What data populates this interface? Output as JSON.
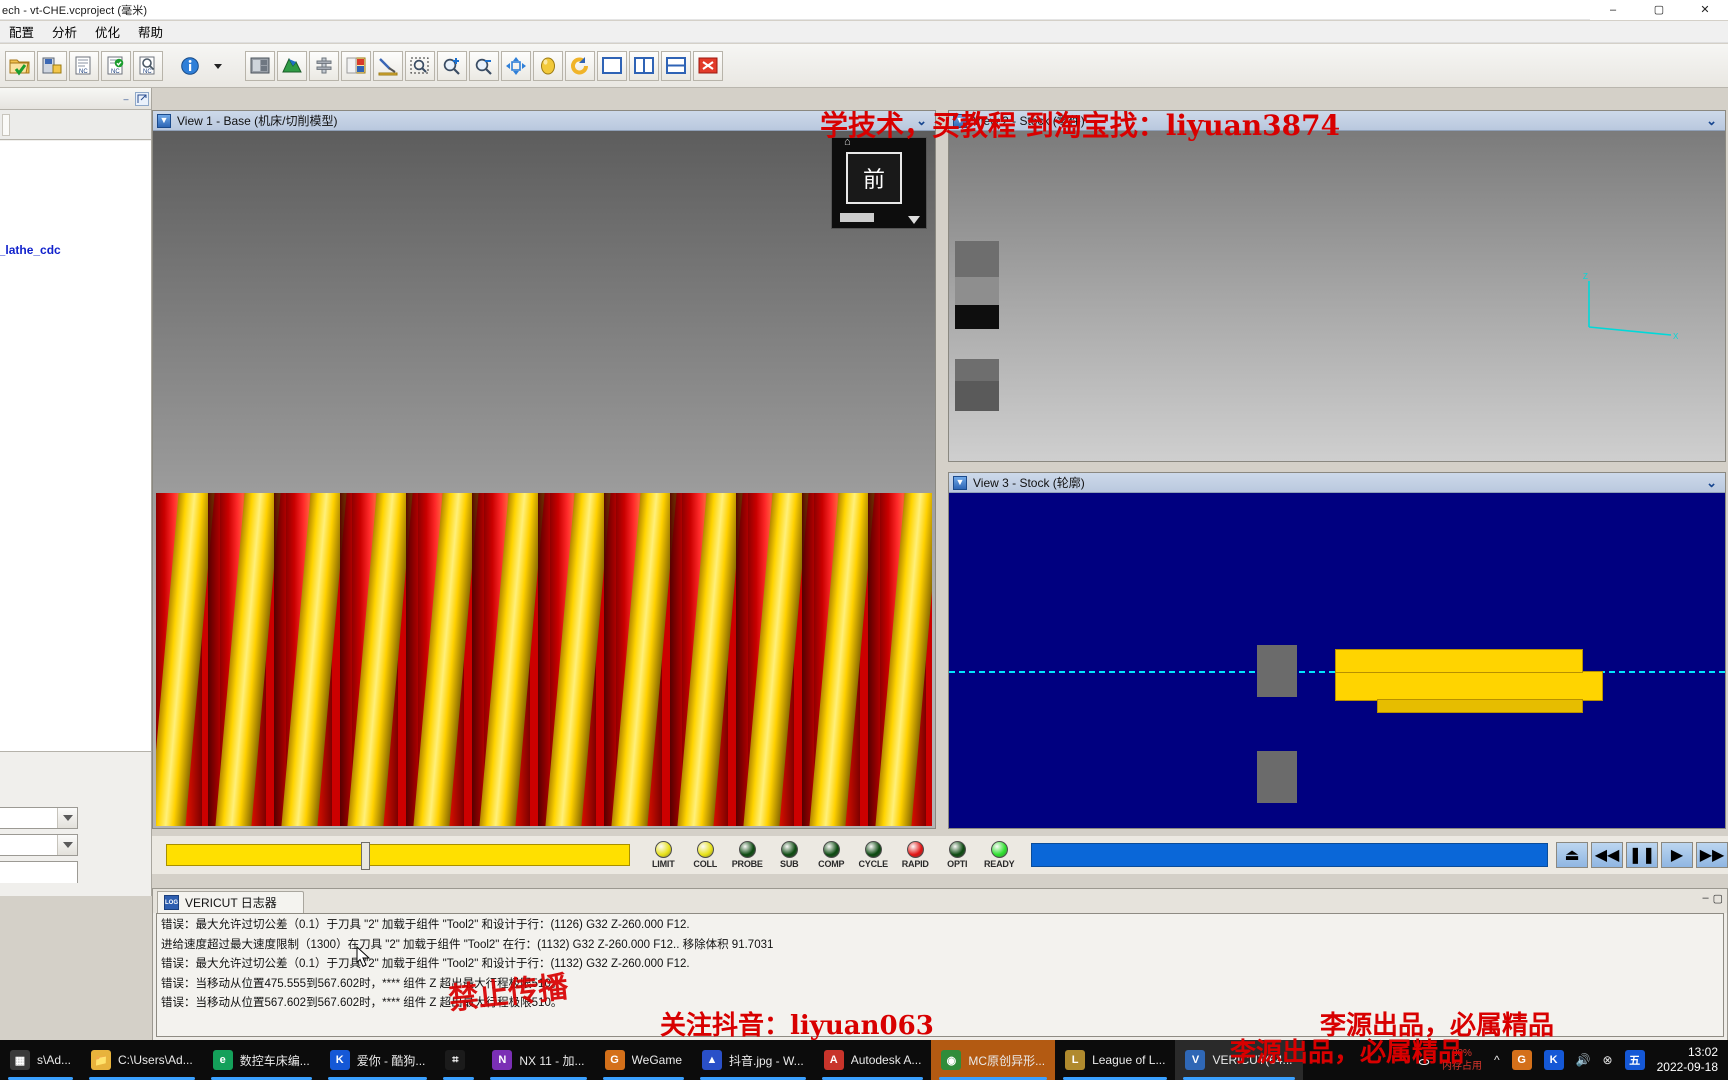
{
  "window": {
    "title": "ech - vt-CHE.vcproject (毫米)",
    "minimize": "–",
    "maximize": "▢",
    "close": "✕"
  },
  "menu": {
    "items": [
      {
        "label": "配置",
        "name": "menu-config"
      },
      {
        "label": "分析",
        "name": "menu-analysis"
      },
      {
        "label": "优化",
        "name": "menu-optimize"
      },
      {
        "label": "帮助",
        "name": "menu-help"
      }
    ]
  },
  "toolbar": {
    "buttons": [
      {
        "name": "open-project-icon",
        "tip": "打开项目"
      },
      {
        "name": "save-project-icon",
        "tip": "保存项目"
      },
      {
        "name": "nc-program-list-icon",
        "tip": "NC 程序"
      },
      {
        "name": "nc-program-check-icon",
        "tip": "NC 程序校验"
      },
      {
        "name": "nc-program-search-icon",
        "tip": "NC 程序查找"
      },
      {
        "name": "info-icon",
        "tip": "信息"
      },
      {
        "name": "dropdown-arrow-icon",
        "tip": "更多"
      },
      {
        "name": "machine-view-icon",
        "tip": "机床视图"
      },
      {
        "name": "workpiece-icon",
        "tip": "工件"
      },
      {
        "name": "fixture-icon",
        "tip": "夹具"
      },
      {
        "name": "tool-manager-icon",
        "tip": "刀具管理"
      },
      {
        "name": "measure-icon",
        "tip": "测量"
      },
      {
        "name": "zoom-box-icon",
        "tip": "框选缩放"
      },
      {
        "name": "zoom-in-icon",
        "tip": "放大"
      },
      {
        "name": "zoom-out-icon",
        "tip": "缩小"
      },
      {
        "name": "fit-icon",
        "tip": "适应窗口"
      },
      {
        "name": "stock-sphere-icon",
        "tip": "毛坯"
      },
      {
        "name": "rotate-icon",
        "tip": "旋转"
      },
      {
        "name": "single-view-icon",
        "tip": "单视图"
      },
      {
        "name": "dual-view-icon",
        "tip": "双视图"
      },
      {
        "name": "split-view-icon",
        "tip": "分割视图"
      },
      {
        "name": "close-view-icon",
        "tip": "关闭视图"
      }
    ]
  },
  "left_panel": {
    "tree_item": "s_turret_lathe_cdc",
    "combo_values": [
      "",
      "",
      ""
    ],
    "minimize_label": "–"
  },
  "views": [
    {
      "id": "view1",
      "title": "View 1 - Base (机床/切削模型)",
      "collapse": "⌄",
      "orientation_cube": {
        "face_label": "前",
        "home_icon": "⌂"
      }
    },
    {
      "id": "view2",
      "title": "View 2 - Stock (零件)",
      "collapse": "⌄",
      "axis_labels": {
        "x": "X",
        "y": "Y",
        "z": "Z"
      }
    },
    {
      "id": "view3",
      "title": "View 3 - Stock (轮廓)",
      "collapse": "⌄"
    }
  ],
  "status_lights": [
    {
      "label": "LIMIT",
      "color": "#e8e218"
    },
    {
      "label": "COLL",
      "color": "#e8e218"
    },
    {
      "label": "PROBE",
      "color": "#0c4a10"
    },
    {
      "label": "SUB",
      "color": "#0c4a10"
    },
    {
      "label": "COMP",
      "color": "#0c4a10"
    },
    {
      "label": "CYCLE",
      "color": "#0c4a10"
    },
    {
      "label": "RAPID",
      "color": "#e11414"
    },
    {
      "label": "OPTI",
      "color": "#0c4a10"
    },
    {
      "label": "READY",
      "color": "#2ce02c"
    }
  ],
  "playback": {
    "progress_color": "#0a67d8",
    "progress_percent": 100,
    "speed_knob_percent": 38,
    "buttons": [
      {
        "name": "reset-button",
        "glyph": "⏏"
      },
      {
        "name": "rewind-button",
        "glyph": "◀◀"
      },
      {
        "name": "pause-button",
        "glyph": "❚❚"
      },
      {
        "name": "play-button",
        "glyph": "▶"
      },
      {
        "name": "fast-forward-button",
        "glyph": "▶▶"
      }
    ]
  },
  "log": {
    "tab_label": "VERICUT 日志器",
    "tab_icon_text": "LOG",
    "minimize": "–",
    "maximize": "▢",
    "lines": [
      "错误：最大允许过切公差（0.1）于刀具 \"2\" 加载于组件 \"Tool2\" 和设计于行：(1126) G32 Z-260.000 F12.",
      "进给速度超过最大速度限制（1300）在刀具 \"2\" 加载于组件 \"Tool2\" 在行：(1132) G32 Z-260.000 F12.. 移除体积 91.7031",
      "错误：最大允许过切公差（0.1）于刀具 \"2\" 加载于组件 \"Tool2\" 和设计于行：(1132) G32 Z-260.000 F12.",
      "错误：当移动从位置475.555到567.602时，**** 组件 Z 超出最大行程极限510。",
      "错误：当移动从位置567.602到567.602时，**** 组件 Z 超出最大行程极限510。"
    ]
  },
  "watermarks": {
    "top": "学技术，买教程  到淘宝找：liyuan3874",
    "middle": "禁止传播",
    "bottom_left": "关注抖音：liyuan063",
    "bottom_right": "李源出品，必属精品",
    "taskbar_overlay": "李源出品，必属精品"
  },
  "taskbar": {
    "items": [
      {
        "label": "s\\Ad...",
        "icon": "▦",
        "icon_bg": "#3a3a3a",
        "state": "normal",
        "name": "taskbar-item-explorer-1"
      },
      {
        "label": "C:\\Users\\Ad...",
        "icon": "📁",
        "icon_bg": "#e8b33c",
        "state": "normal",
        "name": "taskbar-item-explorer-2"
      },
      {
        "label": "数控车床编...",
        "icon": "e",
        "icon_bg": "#14a05a",
        "state": "normal",
        "name": "taskbar-item-browser"
      },
      {
        "label": "爱你 - 酷狗...",
        "icon": "K",
        "icon_bg": "#1558d6",
        "state": "normal",
        "name": "taskbar-item-kugou"
      },
      {
        "label": "",
        "icon": "⌗",
        "icon_bg": "#1b1b1b",
        "state": "normal",
        "name": "taskbar-item-calculator"
      },
      {
        "label": "NX 11 - 加...",
        "icon": "N",
        "icon_bg": "#7b2fb5",
        "state": "normal",
        "name": "taskbar-item-nx"
      },
      {
        "label": "WeGame",
        "icon": "G",
        "icon_bg": "#d4701a",
        "state": "normal",
        "name": "taskbar-item-wegame"
      },
      {
        "label": "抖音.jpg - W...",
        "icon": "▲",
        "icon_bg": "#2a50c8",
        "state": "normal",
        "name": "taskbar-item-photo"
      },
      {
        "label": "Autodesk A...",
        "icon": "A",
        "icon_bg": "#c8342b",
        "state": "normal",
        "name": "taskbar-item-autodesk"
      },
      {
        "label": "MC原创异形...",
        "icon": "◉",
        "icon_bg": "#2f8c3a",
        "state": "orange",
        "name": "taskbar-item-mastercam"
      },
      {
        "label": "League of L...",
        "icon": "L",
        "icon_bg": "#b08a2e",
        "state": "normal",
        "name": "taskbar-item-lol"
      },
      {
        "label": "VERICUT(64...",
        "icon": "V",
        "icon_bg": "#2f67b5",
        "state": "active",
        "name": "taskbar-item-vericut"
      }
    ],
    "tray": {
      "memory_label": "内存占用",
      "memory_percent": "80%",
      "icons": [
        "人",
        "^",
        "◉",
        "K",
        "🔊",
        "⊗",
        "五"
      ],
      "time": "13:02",
      "date": "2022-09-18"
    }
  }
}
